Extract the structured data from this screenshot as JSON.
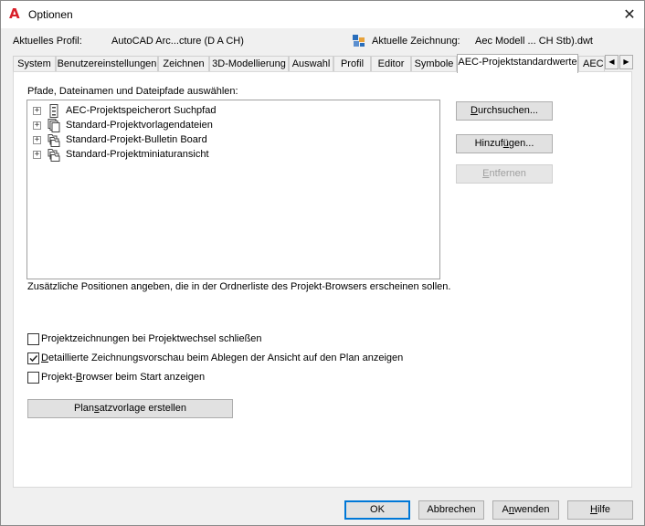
{
  "window": {
    "title": "Optionen",
    "app_icon": "autocad-a-icon",
    "close_glyph": "✕"
  },
  "profile": {
    "label": "Aktuelles Profil:",
    "value": "AutoCAD Arc...cture (D A CH)",
    "drawing_label": "Aktuelle Zeichnung:",
    "drawing_value": "Aec Modell ... CH Stb).dwt"
  },
  "tabs": [
    {
      "label": "System"
    },
    {
      "label": "Benutzereinstellungen"
    },
    {
      "label": "Zeichnen"
    },
    {
      "label": "3D-Modellierung"
    },
    {
      "label": "Auswahl"
    },
    {
      "label": "Profil"
    },
    {
      "label": "Editor"
    },
    {
      "label": "Symbole"
    },
    {
      "label": "AEC-Projektstandardwerte",
      "active": true
    },
    {
      "label": "AEC"
    }
  ],
  "tab_scroll": {
    "left": "◀",
    "right": "▶"
  },
  "panel": {
    "section_label": "Pfade, Dateinamen und Dateipfade auswählen:",
    "tree": [
      {
        "label": "AEC-Projektspeicherort Suchpfad",
        "icon": "cabinet-icon",
        "expander": "+"
      },
      {
        "label": "Standard-Projektvorlagendateien",
        "icon": "stacked-pages-icon",
        "expander": "+"
      },
      {
        "label": "Standard-Projekt-Bulletin Board",
        "icon": "stacked-folders-icon",
        "expander": "+"
      },
      {
        "label": "Standard-Projektminiaturansicht",
        "icon": "stacked-folders-icon",
        "expander": "+"
      }
    ],
    "description": "Zusätzliche Positionen angeben, die in der Ordnerliste des Projekt-Browsers erscheinen sollen.",
    "buttons": {
      "browse": {
        "pre": "",
        "key": "D",
        "post": "urchsuchen..."
      },
      "add": {
        "pre": "Hinzuf",
        "key": "ü",
        "post": "gen..."
      },
      "remove": {
        "pre": "",
        "key": "E",
        "post": "ntfernen"
      }
    },
    "checkboxes": [
      {
        "pre": "Pro",
        "key": "j",
        "post": "ektzeichnungen bei Projektwechsel schließen",
        "checked": false
      },
      {
        "pre": "",
        "key": "D",
        "post": "etaillierte Zeichnungsvorschau beim Ablegen der Ansicht auf den Plan anzeigen",
        "checked": true
      },
      {
        "pre": "Projekt-",
        "key": "B",
        "post": "rowser beim Start anzeigen",
        "checked": false
      }
    ],
    "template_button": {
      "pre": "Plan",
      "key": "s",
      "post": "atzvorlage erstellen"
    }
  },
  "footer": {
    "ok": "OK",
    "cancel": "Abbrechen",
    "apply": {
      "pre": "A",
      "key": "n",
      "post": "wenden"
    },
    "help": {
      "pre": "",
      "key": "H",
      "post": "ilfe"
    }
  },
  "colors": {
    "accent_focus": "#0078d7",
    "app_icon_red": "#d9202a"
  }
}
